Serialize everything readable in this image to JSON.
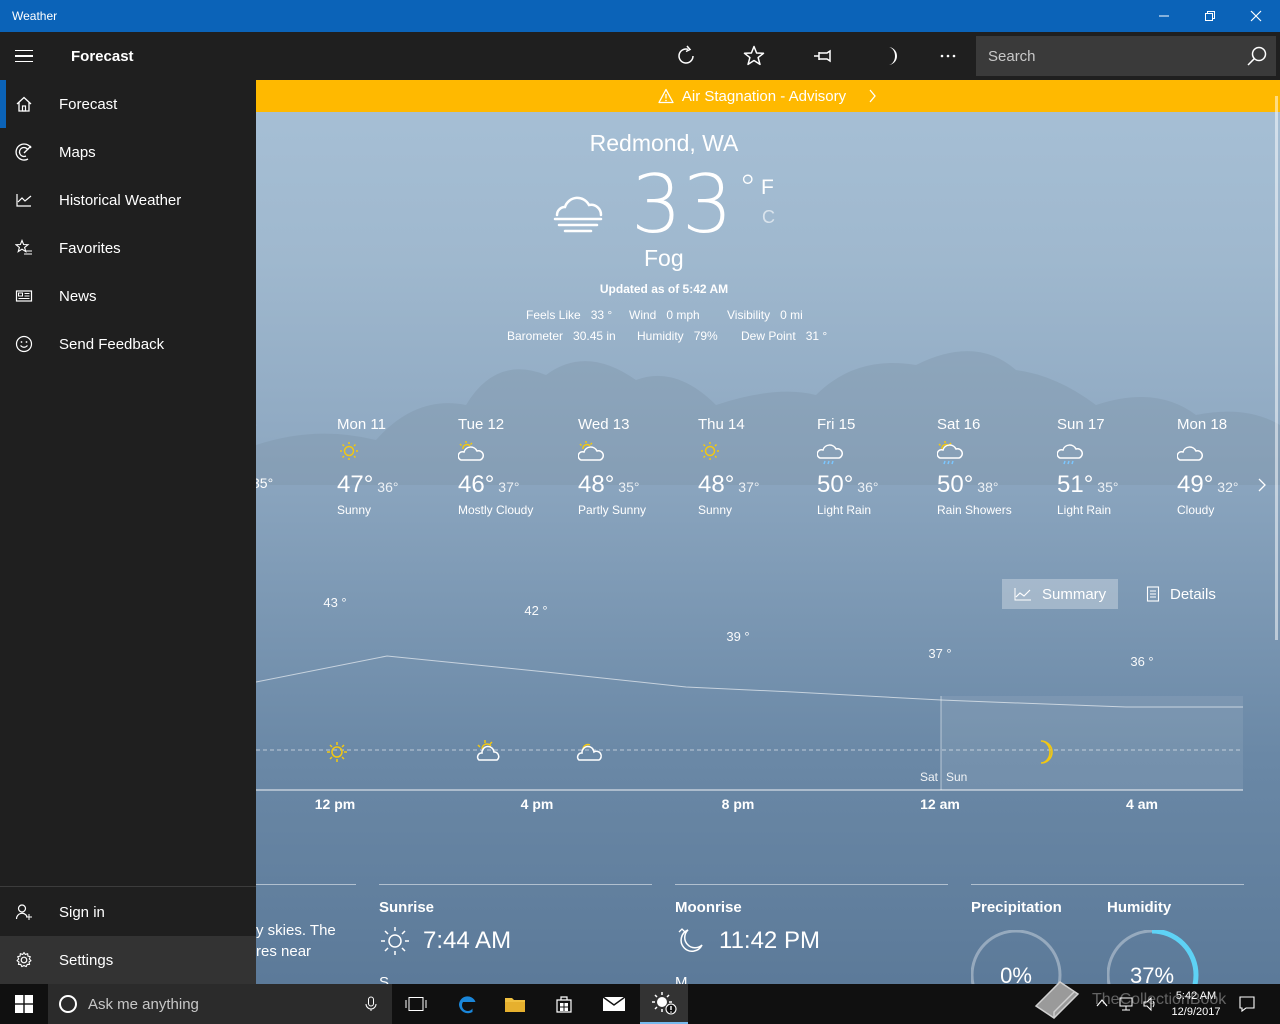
{
  "window": {
    "title": "Weather"
  },
  "appbar": {
    "title": "Forecast",
    "search_placeholder": "Search"
  },
  "sidebar": {
    "items": [
      {
        "label": "Forecast"
      },
      {
        "label": "Maps"
      },
      {
        "label": "Historical Weather"
      },
      {
        "label": "Favorites"
      },
      {
        "label": "News"
      },
      {
        "label": "Send Feedback"
      }
    ],
    "bottom": [
      {
        "label": "Sign in"
      },
      {
        "label": "Settings"
      }
    ]
  },
  "advisory": {
    "text": "Air Stagnation - Advisory"
  },
  "current": {
    "location": "Redmond, WA",
    "temp": "33",
    "degree": "°",
    "unit_f": "F",
    "unit_c": "C",
    "condition": "Fog",
    "updated": "Updated as of 5:42 AM",
    "details": [
      {
        "label": "Feels Like",
        "value": "33 °"
      },
      {
        "label": "Wind",
        "value": "0 mph"
      },
      {
        "label": "Visibility",
        "value": "0 mi"
      },
      {
        "label": "Barometer",
        "value": "30.45 in"
      },
      {
        "label": "Humidity",
        "value": "79%"
      },
      {
        "label": "Dew Point",
        "value": "31 °"
      }
    ]
  },
  "daily": {
    "partial_day_label": ")",
    "partial_low": "35°",
    "days": [
      {
        "day": "Mon 11",
        "hi": "47°",
        "lo": "36°",
        "cond": "Sunny",
        "icon": "sun-icon"
      },
      {
        "day": "Tue 12",
        "hi": "46°",
        "lo": "37°",
        "cond": "Mostly Cloudy",
        "icon": "partly-cloudy-icon"
      },
      {
        "day": "Wed 13",
        "hi": "48°",
        "lo": "35°",
        "cond": "Partly Sunny",
        "icon": "partly-sunny-icon"
      },
      {
        "day": "Thu 14",
        "hi": "48°",
        "lo": "37°",
        "cond": "Sunny",
        "icon": "sun-icon"
      },
      {
        "day": "Fri 15",
        "hi": "50°",
        "lo": "36°",
        "cond": "Light Rain",
        "icon": "rain-icon"
      },
      {
        "day": "Sat 16",
        "hi": "50°",
        "lo": "38°",
        "cond": "Rain Showers",
        "icon": "sun-rain-icon"
      },
      {
        "day": "Sun 17",
        "hi": "51°",
        "lo": "35°",
        "cond": "Light Rain",
        "icon": "rain-icon"
      },
      {
        "day": "Mon 18",
        "hi": "49°",
        "lo": "32°",
        "cond": "Cloudy",
        "icon": "cloud-icon"
      }
    ]
  },
  "view_toggle": {
    "summary": "Summary",
    "details": "Details"
  },
  "hourly": {
    "temps": [
      {
        "label": "43 °",
        "value": 43
      },
      {
        "label": "42 °",
        "value": 42
      },
      {
        "label": "39 °",
        "value": 39
      },
      {
        "label": "37 °",
        "value": 37
      },
      {
        "label": "36 °",
        "value": 36
      }
    ],
    "hours": [
      "12 pm",
      "4 pm",
      "8 pm",
      "12 am",
      "4 am"
    ],
    "day_split": {
      "before": "Sat",
      "after": "Sun"
    }
  },
  "cards": {
    "partial_text_1": "y skies. The",
    "partial_text_2": "res near",
    "sunrise_label": "Sunrise",
    "sunrise_value": "7:44 AM",
    "moonrise_label": "Moonrise",
    "moonrise_value": "11:42 PM",
    "precip_label": "Precipitation",
    "precip_value": "0%",
    "precip_fraction": 0,
    "humidity_label": "Humidity",
    "humidity_value": "37%",
    "humidity_fraction": 0.37,
    "cut_1": "S",
    "cut_2": "M"
  },
  "taskbar": {
    "search_placeholder": "Ask me anything",
    "time": "5:42 AM",
    "date": "12/9/2017",
    "watermark": "TheCollectionBook"
  },
  "colors": {
    "accent": "#0b63b8",
    "advisory": "#ffb900",
    "sun": "#f2c811",
    "gauge": "#5ed2f5"
  }
}
